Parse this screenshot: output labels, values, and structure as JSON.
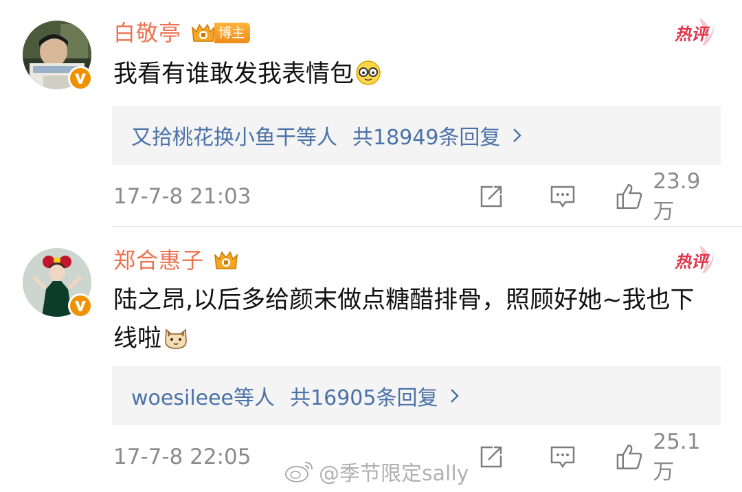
{
  "comments": [
    {
      "username": "白敬亭",
      "badge_label": "博主",
      "hot_label": "热评",
      "text": "我看有谁敢发我表情包",
      "emoji": "glasses-face-emoji",
      "reply_users": "又拾桃花换小鱼干等人",
      "reply_count": "共18949条回复",
      "timestamp": "17-7-8 21:03",
      "likes": "23.9万"
    },
    {
      "username": "郑合惠子",
      "hot_label": "热评",
      "text": "陆之昂,以后多给颜末做点糖醋排骨，照顾好她~我也下线啦",
      "emoji": "cat-face-emoji",
      "reply_users": "woesileee等人",
      "reply_count": "共16905条回复",
      "timestamp": "17-7-8 22:05",
      "likes": "25.1万"
    }
  ],
  "watermark": "@季节限定sally",
  "colors": {
    "username": "#eb7350",
    "link": "#4a72a8",
    "meta": "#8a8a8a",
    "hot": "#e0354a",
    "verified": "#f29100"
  },
  "icons": [
    "share-icon",
    "comment-icon",
    "like-icon",
    "chevron-right-icon",
    "verified-v-icon",
    "crown-badge-icon",
    "weibo-logo-icon"
  ]
}
